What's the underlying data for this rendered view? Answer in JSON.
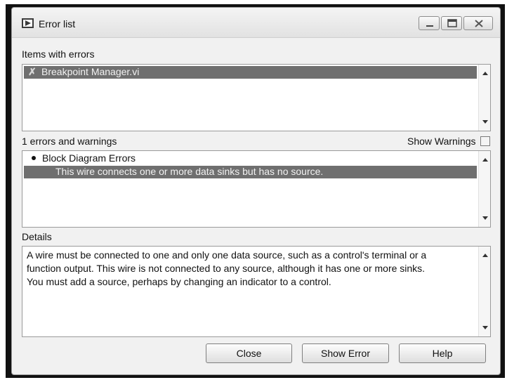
{
  "window": {
    "title": "Error list"
  },
  "items_section": {
    "label": "Items with errors",
    "items": [
      {
        "name": "Breakpoint Manager.vi",
        "selected": true
      }
    ]
  },
  "errors_section": {
    "count_label": "1 errors and warnings",
    "show_warnings_label": "Show Warnings",
    "show_warnings_checked": false,
    "group": "Block Diagram Errors",
    "selected_error": "This wire connects one or more data sinks but has no source."
  },
  "details_section": {
    "label": "Details",
    "line1": "A wire must be connected to one and only one data source, such as a control's terminal or a",
    "line2": "function output. This wire is not connected to any source, although it has one or more sinks.",
    "line3": "You must add a source, perhaps by changing an indicator to a control."
  },
  "buttons": {
    "close": "Close",
    "show_error": "Show Error",
    "help": "Help"
  },
  "icons": {
    "app": "labview-app-icon",
    "error_item": "error-x-icon",
    "bullet": "bullet-icon"
  },
  "colors": {
    "selection": "#6f6f6f",
    "window_bg": "#f1f1f1"
  }
}
